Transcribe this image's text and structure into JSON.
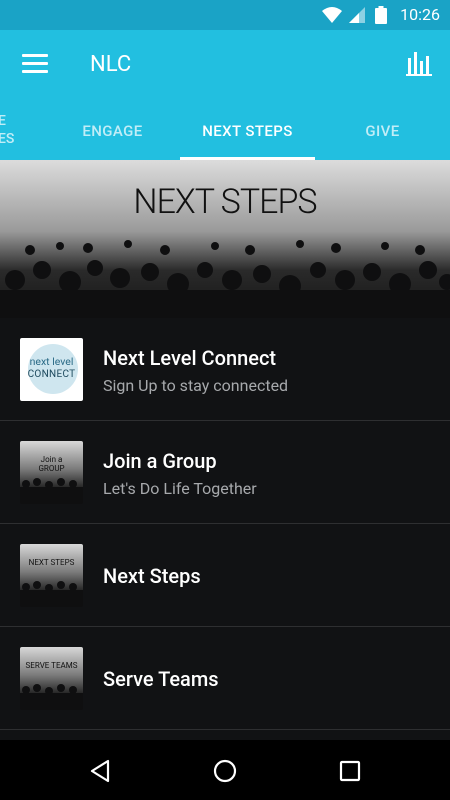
{
  "status_bar": {
    "time": "10:26"
  },
  "app_bar": {
    "title": "NLC"
  },
  "tabs": {
    "partial": "E\nES",
    "items": [
      {
        "label": "ENGAGE",
        "active": false
      },
      {
        "label": "NEXT STEPS",
        "active": true
      },
      {
        "label": "GIVE",
        "active": false
      }
    ]
  },
  "hero": {
    "title": "NEXT STEPS"
  },
  "list": [
    {
      "title": "Next Level Connect",
      "subtitle": "Sign Up to stay connected",
      "thumb_line1": "next level",
      "thumb_line2": "CONNECT"
    },
    {
      "title": "Join a Group",
      "subtitle": "Let's Do Life Together",
      "thumb_line1": "Join a",
      "thumb_line2": "GROUP"
    },
    {
      "title": "Next Steps",
      "subtitle": "",
      "thumb_line1": "NEXT STEPS"
    },
    {
      "title": "Serve Teams",
      "subtitle": "",
      "thumb_line1": "SERVE TEAMS"
    }
  ],
  "colors": {
    "status": "#1aa3c6",
    "accent": "#22bfe0",
    "background": "#111214"
  }
}
